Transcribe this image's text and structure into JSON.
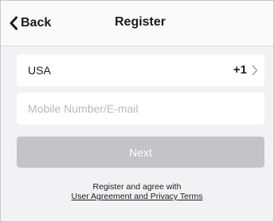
{
  "header": {
    "back_label": "Back",
    "title": "Register",
    "back_icon": "chevron-left-icon"
  },
  "country": {
    "name": "USA",
    "dial_code": "+1",
    "chevron_icon": "chevron-right-icon"
  },
  "account_field": {
    "value": "",
    "placeholder": "Mobile Number/E-mail"
  },
  "next_button": {
    "label": "Next",
    "enabled": false
  },
  "agreement": {
    "text": "Register and agree with",
    "link": "User Agreement and Privacy Terms"
  },
  "colors": {
    "background": "#f2f2f4",
    "disabled_button": "#c4c4c7"
  }
}
